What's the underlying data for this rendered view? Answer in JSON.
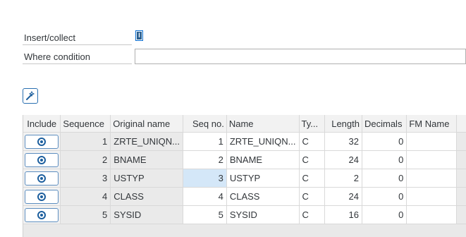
{
  "form": {
    "insert_label": "Insert/collect",
    "insert_value": "I",
    "where_label": "Where condition",
    "where_value": ""
  },
  "table": {
    "headers": {
      "include": "Include",
      "sequence": "Sequence",
      "original_name": "Original name",
      "seq_no": "Seq no.",
      "name": "Name",
      "type": "Ty...",
      "length": "Length",
      "decimals": "Decimals",
      "fm_name": "FM Name"
    },
    "rows": [
      {
        "sequence": "1",
        "original_name": "ZRTE_UNIQN...",
        "seq_no": "1",
        "name": "ZRTE_UNIQN...",
        "type": "C",
        "length": "32",
        "decimals": "0",
        "fm_name": ""
      },
      {
        "sequence": "2",
        "original_name": "BNAME",
        "seq_no": "2",
        "name": "BNAME",
        "type": "C",
        "length": "24",
        "decimals": "0",
        "fm_name": ""
      },
      {
        "sequence": "3",
        "original_name": "USTYP",
        "seq_no": "3",
        "name": "USTYP",
        "type": "C",
        "length": "2",
        "decimals": "0",
        "fm_name": ""
      },
      {
        "sequence": "4",
        "original_name": "CLASS",
        "seq_no": "4",
        "name": "CLASS",
        "type": "C",
        "length": "24",
        "decimals": "0",
        "fm_name": ""
      },
      {
        "sequence": "5",
        "original_name": "SYSID",
        "seq_no": "5",
        "name": "SYSID",
        "type": "C",
        "length": "16",
        "decimals": "0",
        "fm_name": ""
      }
    ]
  },
  "colors": {
    "accent": "#0a6ed1",
    "selected_cell": "#d4e7f8"
  }
}
